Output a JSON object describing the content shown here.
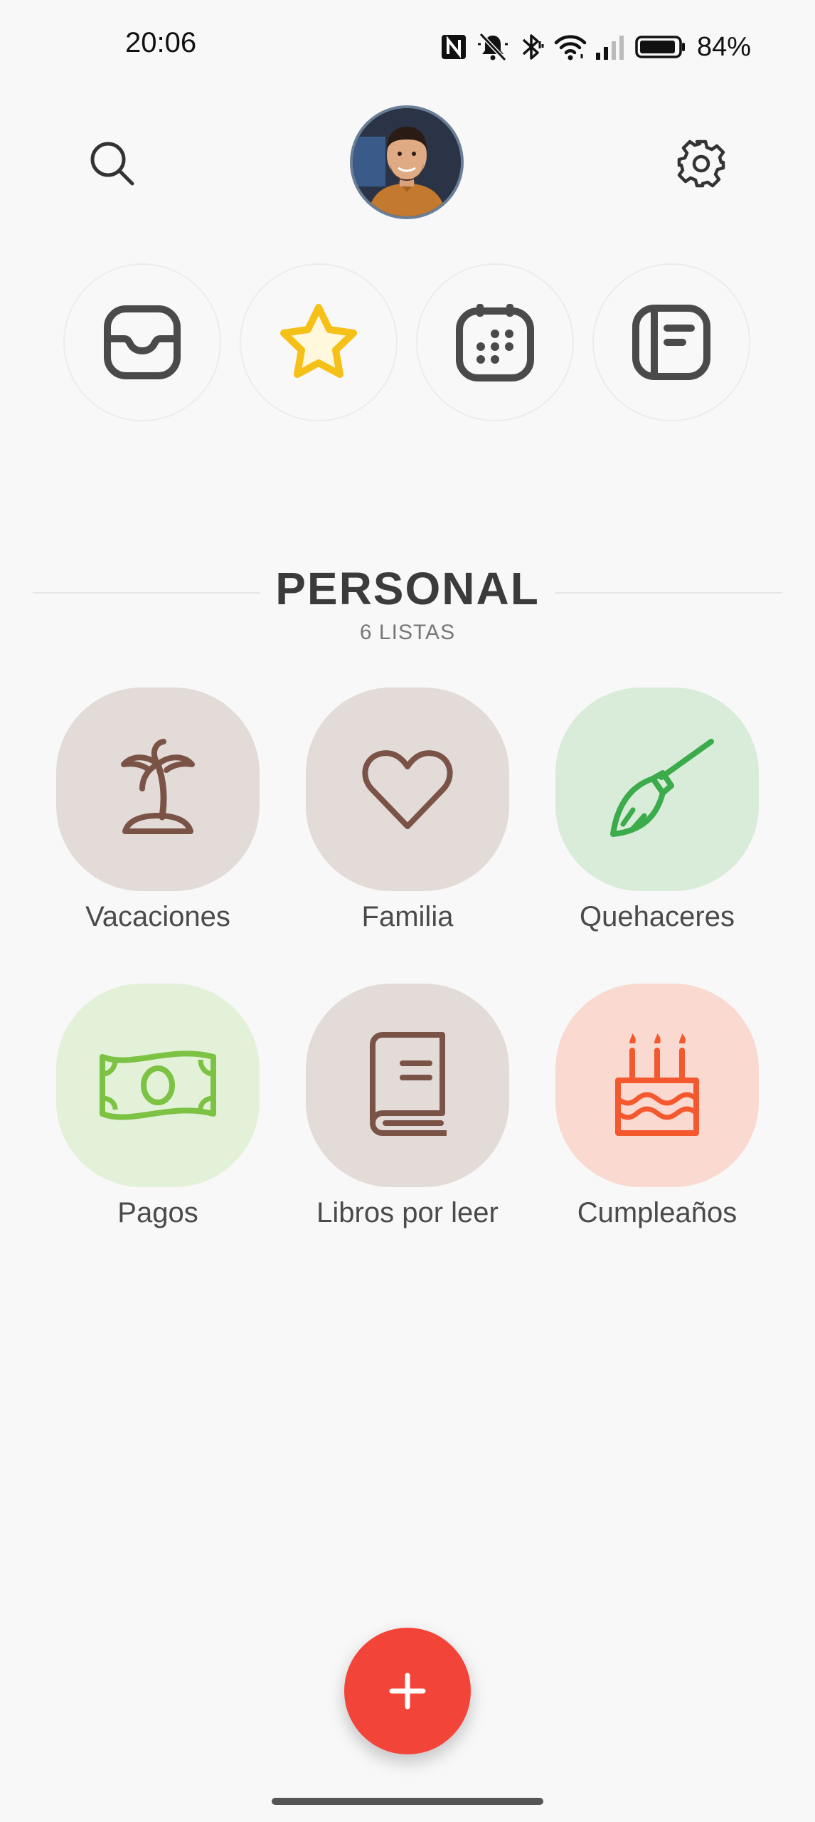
{
  "status_bar": {
    "time": "20:06",
    "battery_percent": "84%",
    "icons": [
      "nfc-icon",
      "muted-bell-icon",
      "bluetooth-icon",
      "wifi-icon",
      "signal-icon",
      "battery-icon"
    ]
  },
  "header": {
    "left_icon": "search-icon",
    "center": "avatar",
    "right_icon": "gear-icon"
  },
  "smart_lists": [
    {
      "icon": "inbox-icon",
      "color": "#4a4a4a"
    },
    {
      "icon": "star-icon",
      "color": "#f5c018"
    },
    {
      "icon": "calendar-icon",
      "color": "#4a4a4a"
    },
    {
      "icon": "notes-icon",
      "color": "#4a4a4a"
    }
  ],
  "section": {
    "title": "PERSONAL",
    "subtitle": "6 LISTAS"
  },
  "lists": [
    {
      "label": "Vacaciones",
      "icon": "palm-tree-icon",
      "bg": "#e2dbd8",
      "fg": "#7a5346"
    },
    {
      "label": "Familia",
      "icon": "heart-icon",
      "bg": "#e2dbd8",
      "fg": "#7a5346"
    },
    {
      "label": "Quehaceres",
      "icon": "broom-icon",
      "bg": "#d8ecd9",
      "fg": "#3cab4c"
    },
    {
      "label": "Pagos",
      "icon": "money-bill-icon",
      "bg": "#e3f1d9",
      "fg": "#7cc243"
    },
    {
      "label": "Libros por leer",
      "icon": "book-icon",
      "bg": "#e2dbd8",
      "fg": "#7a5346"
    },
    {
      "label": "Cumpleaños",
      "icon": "birthday-cake-icon",
      "bg": "#fad9d0",
      "fg": "#f4582e"
    }
  ],
  "fab": {
    "icon": "plus-icon",
    "color": "#f24438"
  }
}
